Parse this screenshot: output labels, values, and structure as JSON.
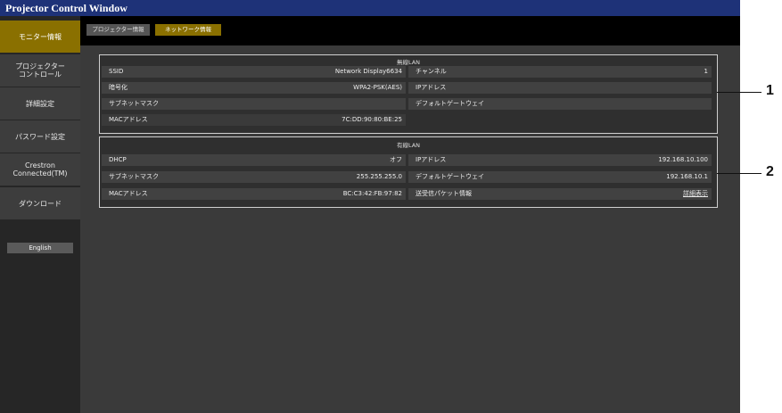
{
  "window": {
    "title": "Projector Control Window"
  },
  "sidebar": {
    "items": [
      {
        "label": "モニター情報"
      },
      {
        "label_line1": "プロジェクター",
        "label_line2": "コントロール"
      },
      {
        "label": "詳細設定"
      },
      {
        "label": "パスワード設定"
      },
      {
        "label_line1": "Crestron",
        "label_line2": "Connected(TM)"
      },
      {
        "label": "ダウンロード"
      }
    ],
    "language_button": "English"
  },
  "tabs": [
    {
      "label": "プロジェクター情報"
    },
    {
      "label": "ネットワーク情報"
    }
  ],
  "wireless": {
    "title": "無線LAN",
    "rows": [
      {
        "left_label": "SSID",
        "left_value": "Network Display6634",
        "right_label": "チャンネル",
        "right_value": "1"
      },
      {
        "left_label": "暗号化",
        "left_value": "WPA2-PSK(AES)",
        "right_label": "IPアドレス",
        "right_value": ""
      },
      {
        "left_label": "サブネットマスク",
        "left_value": "",
        "right_label": "デフォルトゲートウェイ",
        "right_value": ""
      },
      {
        "left_label": "MACアドレス",
        "left_value": "7C:DD:90:80:BE:25"
      }
    ]
  },
  "wired": {
    "title": "有線LAN",
    "rows": [
      {
        "left_label": "DHCP",
        "left_value": "オフ",
        "right_label": "IPアドレス",
        "right_value": "192.168.10.100"
      },
      {
        "left_label": "サブネットマスク",
        "left_value": "255.255.255.0",
        "right_label": "デフォルトゲートウェイ",
        "right_value": "192.168.10.1"
      },
      {
        "left_label": "MACアドレス",
        "left_value": "BC:C3:42:FB:97:82",
        "right_label": "送受信パケット情報",
        "right_value": "詳細表示"
      }
    ]
  },
  "callouts": {
    "one": "1",
    "two": "2"
  },
  "colors": {
    "accent": "#8a7000",
    "titlebar": "#1e3278"
  }
}
